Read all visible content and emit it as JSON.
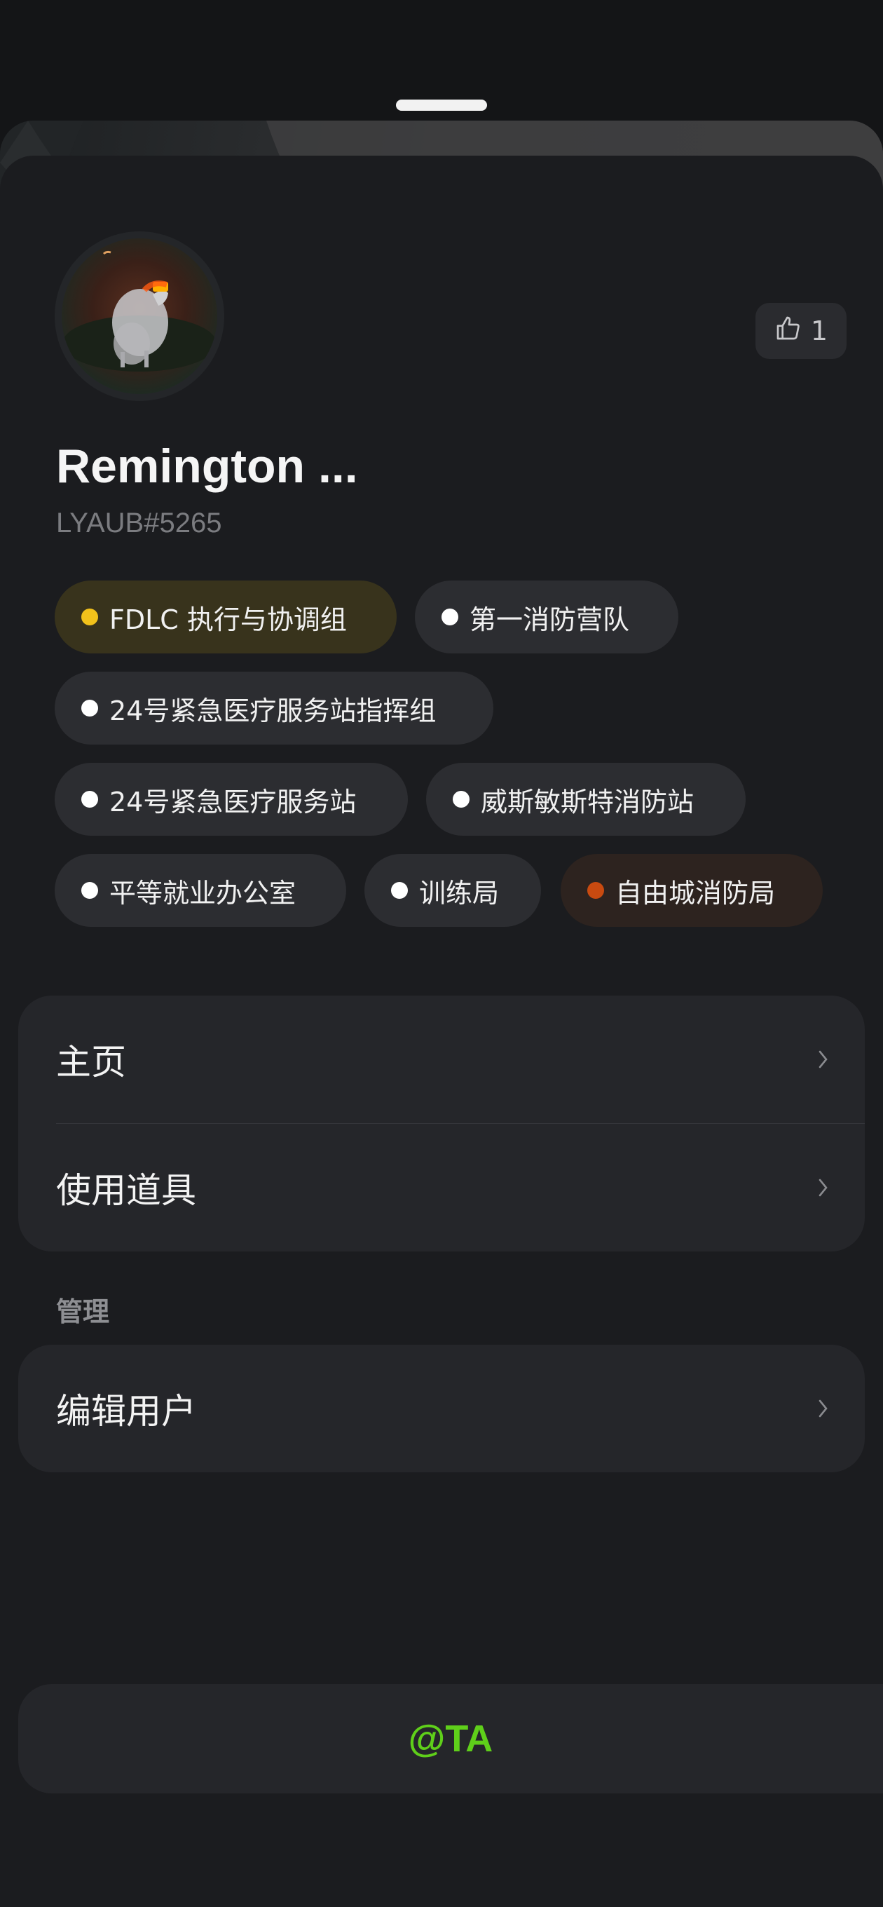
{
  "profile": {
    "name": "Remington ...",
    "tag": "LYAUB#5265",
    "likes": "1",
    "avatar": {
      "description_icon": "avatar-photo"
    }
  },
  "chips": [
    {
      "label": "FDLC 执行与协调组",
      "dot_color": "#f2c21b",
      "bg_color": "#38331c"
    },
    {
      "label": "第一消防营队",
      "dot_color": "#ffffff",
      "bg_color": "#2c2d31"
    },
    {
      "label": "24号紧急医疗服务站指挥组",
      "dot_color": "#ffffff",
      "bg_color": "#2c2d31"
    },
    {
      "label": "24号紧急医疗服务站",
      "dot_color": "#ffffff",
      "bg_color": "#2c2d31"
    },
    {
      "label": "威斯敏斯特消防站",
      "dot_color": "#ffffff",
      "bg_color": "#2c2d31"
    },
    {
      "label": "平等就业办公室",
      "dot_color": "#ffffff",
      "bg_color": "#2c2d31"
    },
    {
      "label": "训练局",
      "dot_color": "#ffffff",
      "bg_color": "#2c2d31"
    },
    {
      "label": "自由城消防局",
      "dot_color": "#c84a10",
      "bg_color": "#2d231f"
    }
  ],
  "menu": {
    "home_label": "主页",
    "use_item_label": "使用道具"
  },
  "admin": {
    "section_label": "管理",
    "edit_user_label": "编辑用户"
  },
  "mention_button": {
    "label": "@TA",
    "color": "#5fcf1a"
  },
  "icons": {
    "like": "thumbs-up-icon",
    "chevron": "chevron-right-icon"
  }
}
